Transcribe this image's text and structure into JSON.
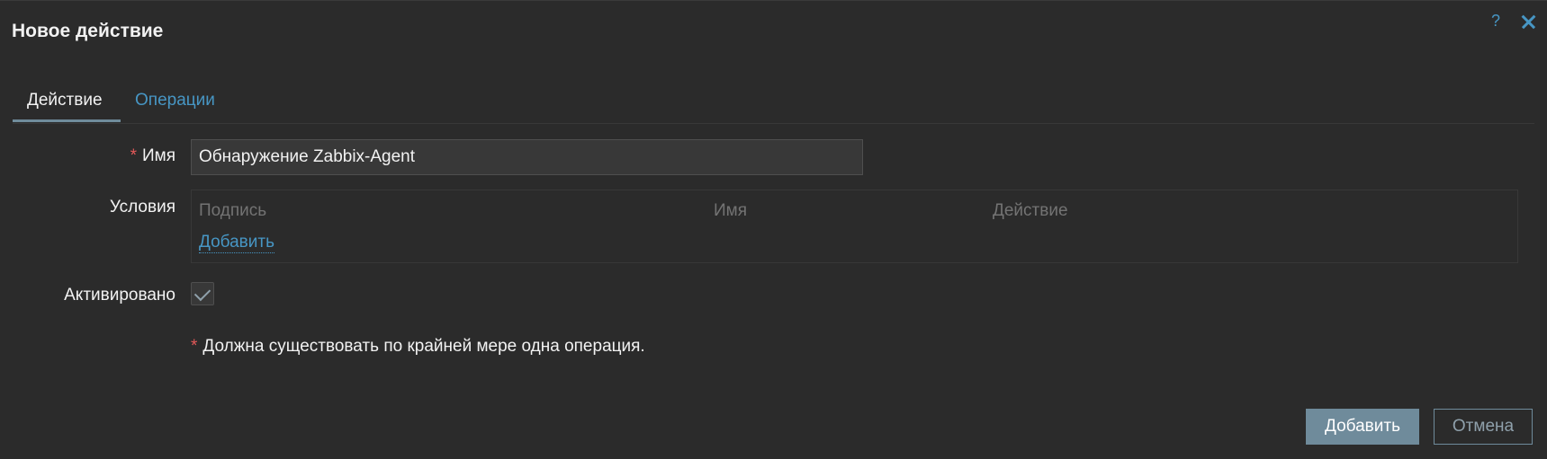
{
  "dialog": {
    "title": "Новое действие",
    "help_icon": "?",
    "close_icon": "close-icon"
  },
  "tabs": [
    {
      "label": "Действие",
      "active": true
    },
    {
      "label": "Операции",
      "active": false
    }
  ],
  "form": {
    "name_label": "Имя",
    "name_required_mark": "*",
    "name_value": "Обнаружение Zabbix-Agent",
    "conditions_label": "Условия",
    "conditions_columns": [
      "Подпись",
      "Имя",
      "Действие"
    ],
    "conditions_add_link": "Добавить",
    "enabled_label": "Активировано",
    "enabled_checked": true,
    "notice_mark": "*",
    "notice_text": "Должна существовать по крайней мере одна операция."
  },
  "footer": {
    "add_button": "Добавить",
    "cancel_button": "Отмена"
  },
  "colors": {
    "background": "#2b2b2b",
    "link": "#4796c4",
    "required": "#e45959",
    "button_primary": "#6f8b9b"
  }
}
